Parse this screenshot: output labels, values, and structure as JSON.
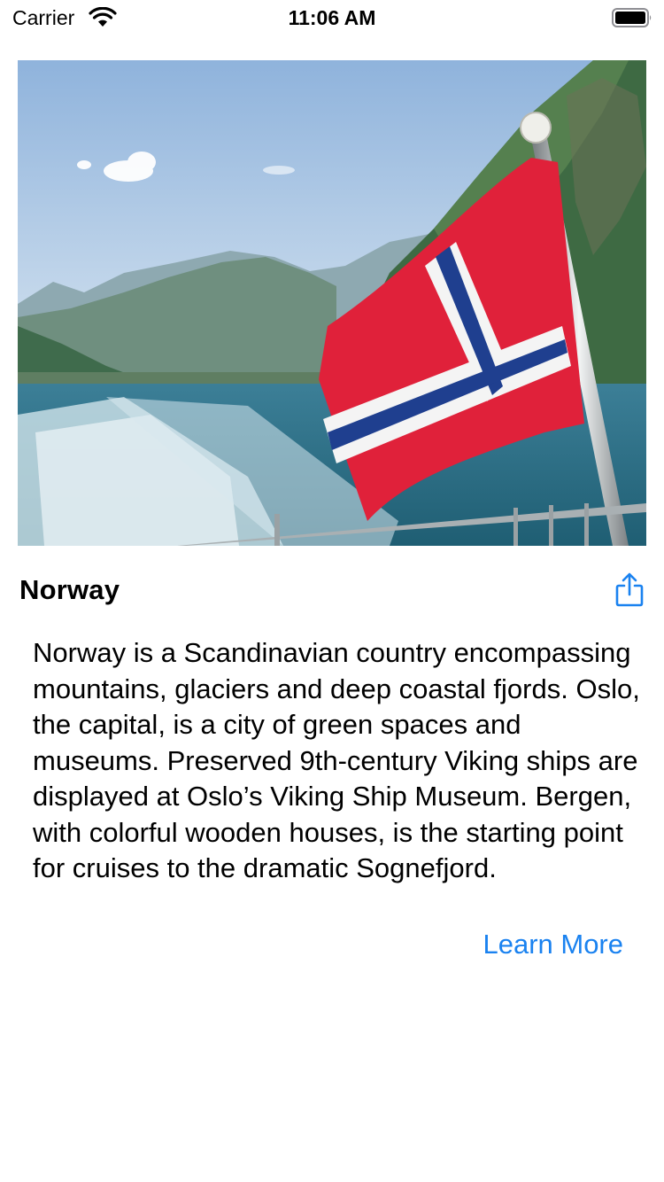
{
  "status_bar": {
    "carrier": "Carrier",
    "time": "11:06 AM",
    "icons": [
      "wifi-icon",
      "battery-icon"
    ]
  },
  "hero_image": {
    "subject": "Norwegian flag on a boat railing over a fjord with mountains"
  },
  "card": {
    "title": "Norway",
    "share_icon": "share-icon",
    "description": "Norway is a Scandinavian country encompassing mountains, glaciers and deep coastal fjords. Oslo, the capital, is a city of green spaces and museums. Preserved 9th-century Viking ships are displayed at Oslo’s Viking Ship Museum. Bergen, with colorful wooden houses, is the starting point for cruises to the dramatic Sognefjord.",
    "learn_more_label": "Learn More"
  },
  "colors": {
    "accent": "#1a82f0",
    "flag_red": "#e0213a",
    "flag_blue": "#1f3f8f",
    "water": "#2e6f87",
    "sky": "#a9c6e3"
  }
}
